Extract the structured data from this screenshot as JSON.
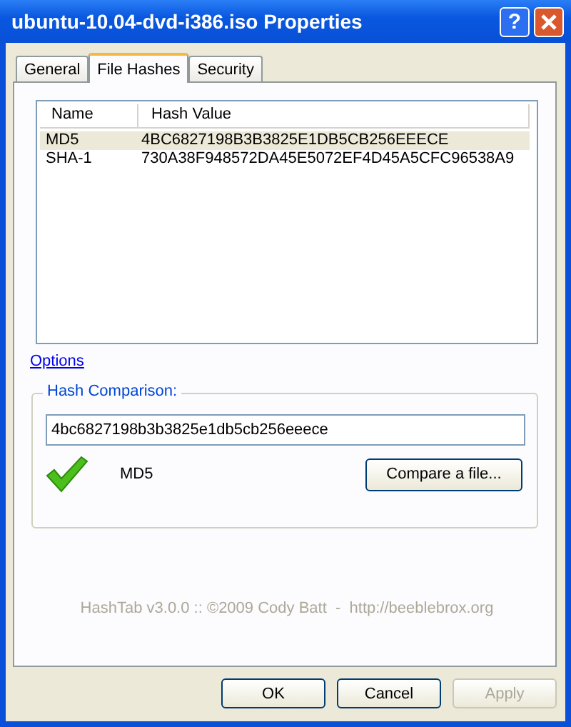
{
  "window": {
    "title": "ubuntu-10.04-dvd-i386.iso Properties",
    "help": "?"
  },
  "tabs": [
    {
      "label": "General",
      "selected": false
    },
    {
      "label": "File Hashes",
      "selected": true
    },
    {
      "label": "Security",
      "selected": false
    }
  ],
  "hash_list": {
    "columns": [
      "Name",
      "Hash Value"
    ],
    "rows": [
      {
        "name": "MD5",
        "hash": "4BC6827198B3B3825E1DB5CB256EEECE",
        "selected": true
      },
      {
        "name": "SHA-1",
        "hash": "730A38F948572DA45E5072EF4D45A5CFC96538A9",
        "selected": false
      }
    ]
  },
  "options_link": "Options",
  "hash_comparison": {
    "label": "Hash Comparison:",
    "value": "4bc6827198b3b3825e1db5cb256eeece",
    "match": true,
    "algorithm": "MD5",
    "compare_button": "Compare a file..."
  },
  "footer": "HashTab v3.0.0 :: ©2009 Cody Batt  -  http://beeblebrox.org",
  "buttons": [
    {
      "label": "OK",
      "disabled": false
    },
    {
      "label": "Cancel",
      "disabled": false
    },
    {
      "label": "Apply",
      "disabled": true
    }
  ]
}
